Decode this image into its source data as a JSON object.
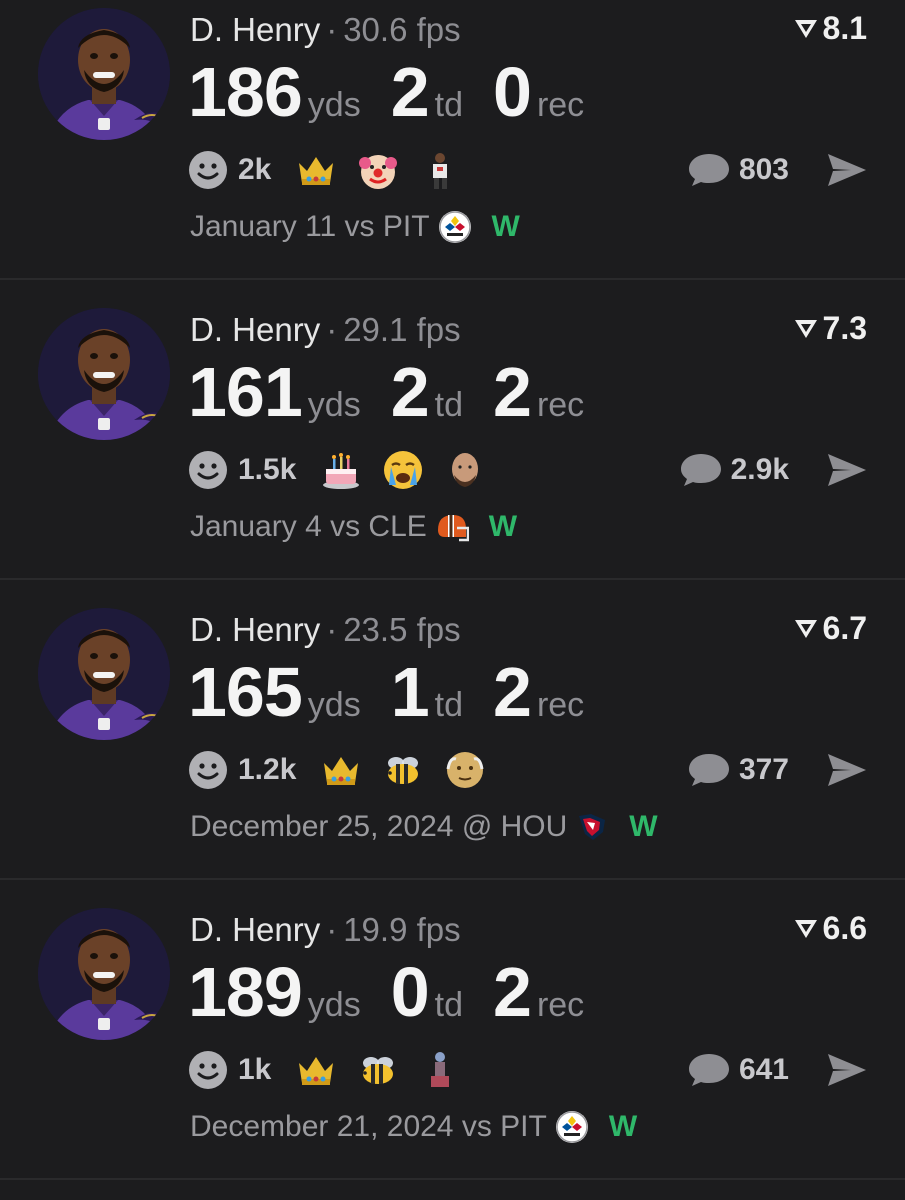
{
  "colors": {
    "background": "#1c1c1e",
    "win": "#2fb86a",
    "muted": "#8e8e93",
    "ravens_purple": "#5a3a9c"
  },
  "posts": [
    {
      "player": "D. Henry",
      "separator": "·",
      "fps": "30.6 fps",
      "score": "8.1",
      "yds": "186",
      "yds_label": "yds",
      "td": "2",
      "td_label": "td",
      "rec": "0",
      "rec_label": "rec",
      "reaction_count": "2k",
      "emojis": [
        "crown-icon",
        "clown-icon",
        "player-icon"
      ],
      "comments": "803",
      "date": "January 11 vs PIT",
      "opponent_logo": "steelers-logo-icon",
      "result": "W"
    },
    {
      "player": "D. Henry",
      "separator": "·",
      "fps": "29.1 fps",
      "score": "7.3",
      "yds": "161",
      "yds_label": "yds",
      "td": "2",
      "td_label": "td",
      "rec": "2",
      "rec_label": "rec",
      "reaction_count": "1.5k",
      "emojis": [
        "cake-icon",
        "crying-face-icon",
        "bald-man-icon"
      ],
      "comments": "2.9k",
      "date": "January 4 vs CLE",
      "opponent_logo": "browns-helmet-icon",
      "result": "W"
    },
    {
      "player": "D. Henry",
      "separator": "·",
      "fps": "23.5 fps",
      "score": "6.7",
      "yds": "165",
      "yds_label": "yds",
      "td": "1",
      "td_label": "td",
      "rec": "2",
      "rec_label": "rec",
      "reaction_count": "1.2k",
      "emojis": [
        "crown-icon",
        "bee-icon",
        "older-man-icon"
      ],
      "comments": "377",
      "date": "December 25, 2024 @ HOU",
      "opponent_logo": "texans-logo-icon",
      "result": "W"
    },
    {
      "player": "D. Henry",
      "separator": "·",
      "fps": "19.9 fps",
      "score": "6.6",
      "yds": "189",
      "yds_label": "yds",
      "td": "0",
      "td_label": "td",
      "rec": "2",
      "rec_label": "rec",
      "reaction_count": "1k",
      "emojis": [
        "crown-icon",
        "bee-icon",
        "statue-icon"
      ],
      "comments": "641",
      "date": "December 21, 2024 vs PIT",
      "opponent_logo": "steelers-logo-icon",
      "result": "W"
    }
  ]
}
